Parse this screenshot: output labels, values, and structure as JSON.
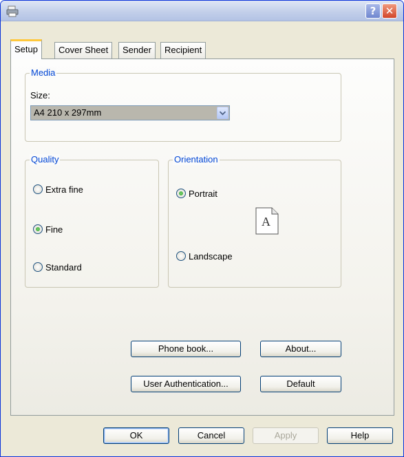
{
  "window": {
    "title": "",
    "icons": {
      "app": "printer-icon",
      "help": "question-mark-icon",
      "close": "close-x-icon"
    },
    "help_label": "?",
    "close_label": "✕"
  },
  "tabs": [
    {
      "label": "Setup",
      "active": true
    },
    {
      "label": "Cover Sheet",
      "active": false
    },
    {
      "label": "Sender",
      "active": false
    },
    {
      "label": "Recipient",
      "active": false
    }
  ],
  "media": {
    "group_label": "Media",
    "size_label": "Size:",
    "size_value": "A4 210 x 297mm"
  },
  "quality": {
    "group_label": "Quality",
    "options": [
      {
        "label": "Extra fine",
        "checked": false
      },
      {
        "label": "Fine",
        "checked": true
      },
      {
        "label": "Standard",
        "checked": false
      }
    ]
  },
  "orientation": {
    "group_label": "Orientation",
    "options": [
      {
        "label": "Portrait",
        "checked": true
      },
      {
        "label": "Landscape",
        "checked": false
      }
    ],
    "preview_letter": "A"
  },
  "buttons": {
    "phone_book": "Phone book...",
    "about": "About...",
    "user_auth": "User Authentication...",
    "default": "Default"
  },
  "footer": {
    "ok": "OK",
    "cancel": "Cancel",
    "apply": "Apply",
    "help": "Help"
  },
  "colors": {
    "group_label": "#0046d5",
    "active_tab_accent": "#ffc83c",
    "button_border": "#003c74"
  }
}
